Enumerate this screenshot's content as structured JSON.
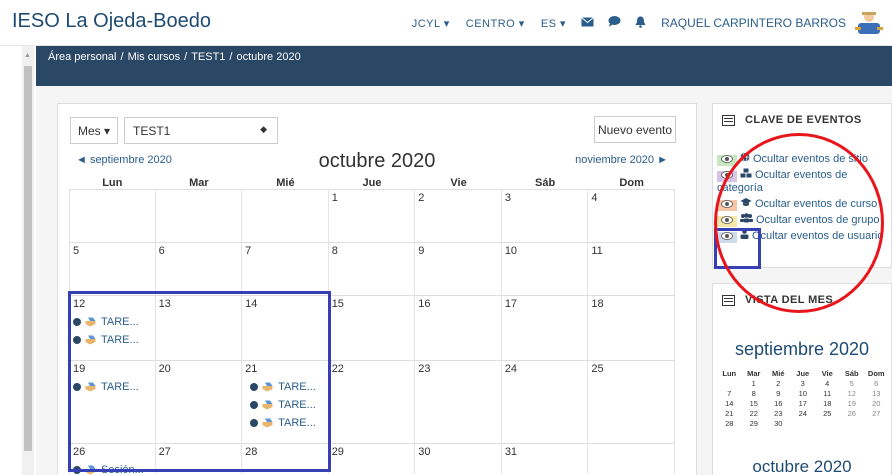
{
  "site": {
    "name": "IESO La Ojeda-Boedo"
  },
  "topnav": {
    "items": [
      "JCYL",
      "CENTRO",
      "ES"
    ],
    "user_name": "RAQUEL CARPINTERO BARROS"
  },
  "breadcrumb": [
    "Área personal",
    "Mis cursos",
    "TEST1",
    "octubre 2020"
  ],
  "toolbar": {
    "view_label": "Mes",
    "course_value": "TEST1",
    "new_event_label": "Nuevo evento"
  },
  "calendar": {
    "prev_label": "◄  septiembre 2020",
    "title": "octubre 2020",
    "next_label": "noviembre 2020  ►",
    "weekdays": [
      "Lun",
      "Mar",
      "Mié",
      "Jue",
      "Vie",
      "Sáb",
      "Dom"
    ],
    "weeks": [
      {
        "days": [
          {
            "d": "",
            "events": []
          },
          {
            "d": "",
            "events": []
          },
          {
            "d": "",
            "events": []
          },
          {
            "d": "1",
            "events": []
          },
          {
            "d": "2",
            "events": []
          },
          {
            "d": "3",
            "events": []
          },
          {
            "d": "4",
            "events": []
          }
        ]
      },
      {
        "days": [
          {
            "d": "5",
            "events": []
          },
          {
            "d": "6",
            "events": []
          },
          {
            "d": "7",
            "events": []
          },
          {
            "d": "8",
            "events": []
          },
          {
            "d": "9",
            "events": []
          },
          {
            "d": "10",
            "events": []
          },
          {
            "d": "11",
            "events": []
          }
        ]
      },
      {
        "days": [
          {
            "d": "12",
            "events": [
              "TARE...",
              "TARE..."
            ]
          },
          {
            "d": "13",
            "events": []
          },
          {
            "d": "14",
            "events": []
          },
          {
            "d": "15",
            "events": []
          },
          {
            "d": "16",
            "events": []
          },
          {
            "d": "17",
            "events": []
          },
          {
            "d": "18",
            "events": []
          }
        ]
      },
      {
        "days": [
          {
            "d": "19",
            "events": [
              "TARE..."
            ]
          },
          {
            "d": "20",
            "events": []
          },
          {
            "d": "21",
            "events": [
              "TARE...",
              "TARE...",
              "TARE..."
            ]
          },
          {
            "d": "22",
            "events": []
          },
          {
            "d": "23",
            "events": []
          },
          {
            "d": "24",
            "events": []
          },
          {
            "d": "25",
            "events": []
          }
        ]
      },
      {
        "days": [
          {
            "d": "26",
            "events": [
              "Sesión..."
            ]
          },
          {
            "d": "27",
            "events": []
          },
          {
            "d": "28",
            "events": []
          },
          {
            "d": "29",
            "events": []
          },
          {
            "d": "30",
            "events": []
          },
          {
            "d": "31",
            "events": []
          },
          {
            "d": "",
            "events": []
          }
        ]
      }
    ]
  },
  "clave": {
    "title": "CLAVE DE EVENTOS",
    "items": [
      {
        "text": "Ocultar eventos de sitio",
        "icon": "globe-icon",
        "color": "#c8e6c0"
      },
      {
        "text": "Ocultar eventos de categoría",
        "icon": "cubes-icon",
        "color": "#d9c4e6"
      },
      {
        "text": "Ocultar eventos de curso",
        "icon": "graduation-cap-icon",
        "color": "#f7c6a8"
      },
      {
        "text": "Ocultar eventos de grupo",
        "icon": "group-icon",
        "color": "#f5e7a8"
      },
      {
        "text": "Ocultar eventos de usuario",
        "icon": "user-icon",
        "color": "#cfdcec"
      }
    ]
  },
  "vista": {
    "title": "VISTA DEL MES",
    "month_title": "septiembre 2020",
    "weekdays": [
      "Lun",
      "Mar",
      "Mié",
      "Jue",
      "Vie",
      "Sáb",
      "Dom"
    ],
    "weeks": [
      [
        "",
        "1",
        "2",
        "3",
        "4",
        "5",
        "6"
      ],
      [
        "7",
        "8",
        "9",
        "10",
        "11",
        "12",
        "13"
      ],
      [
        "14",
        "15",
        "16",
        "17",
        "18",
        "19",
        "20"
      ],
      [
        "21",
        "22",
        "23",
        "24",
        "25",
        "26",
        "27"
      ],
      [
        "28",
        "29",
        "30",
        "",
        "",
        "",
        ""
      ]
    ],
    "next_month_title": "octubre 2020"
  },
  "colors": {
    "header_band": "#2b4766",
    "link": "#2a5e8c",
    "annotation_blue": "#3540b5",
    "annotation_red": "#e8161c"
  }
}
